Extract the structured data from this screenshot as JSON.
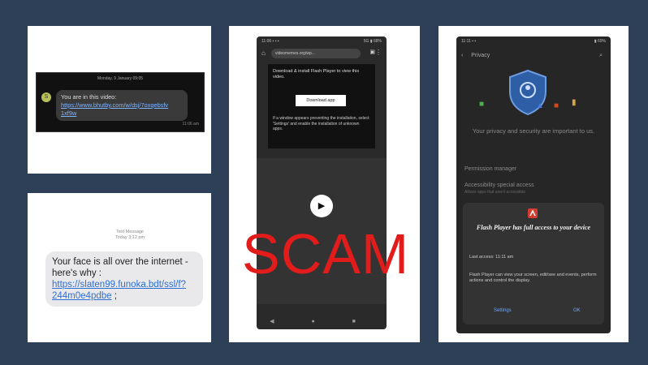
{
  "sms_dark": {
    "header": "Monday, 9 January 09:05",
    "avatar_letter": "S",
    "message_text": "You are in this video: ",
    "message_link": "https://www.bhutby.com/w/dsj/7oxqebsfv 1xf9w",
    "time": "11:06 am"
  },
  "sms_light": {
    "header_line1": "Text Message",
    "header_line2": "Today 3:12 pm",
    "message_text": "Your face is all over the internet - here's why : ",
    "message_link": "https://slaten99.funoka.bdt/ssl/f?244m0e4pdbe",
    "message_end": " ;"
  },
  "browser_phone": {
    "status_left": "11:06 ▪ ▪ ▪",
    "status_right": "5G ▮ 68%",
    "url": "videomemes.org/wp...",
    "home_icon": "home-icon",
    "tabs_icon": "tabs-icon",
    "dialog_text": "Download & install Flash Player to view this video.",
    "download_button": "Download app",
    "dialog_note": "If a window appears preventing the installation, select 'Settings' and enable the installation of unknown apps.",
    "play_icon": "play-icon",
    "nav": "◀ ● ■"
  },
  "scam_label": "SCAM",
  "privacy_phone": {
    "status_left": "11:11 ▪ ▪",
    "status_right": "▮ 69%",
    "title": "Privacy",
    "tagline": "Your privacy and security are important to us.",
    "section1": "Permission manager",
    "section2": "Accessibility special access",
    "section2_sub": "Allows apps that aren't accessible",
    "modal_title": "Flash Player has full access to your device",
    "modal_sub": "Last access: 11:11 am",
    "modal_desc": "Flash Player can view your screen, edit/see and events, perform actions and control the display.",
    "btn_settings": "Settings",
    "btn_ok": "OK"
  },
  "colors": {
    "background": "#2e4057",
    "scam_red": "#e21b1b",
    "link_blue": "#2f6fd3"
  }
}
